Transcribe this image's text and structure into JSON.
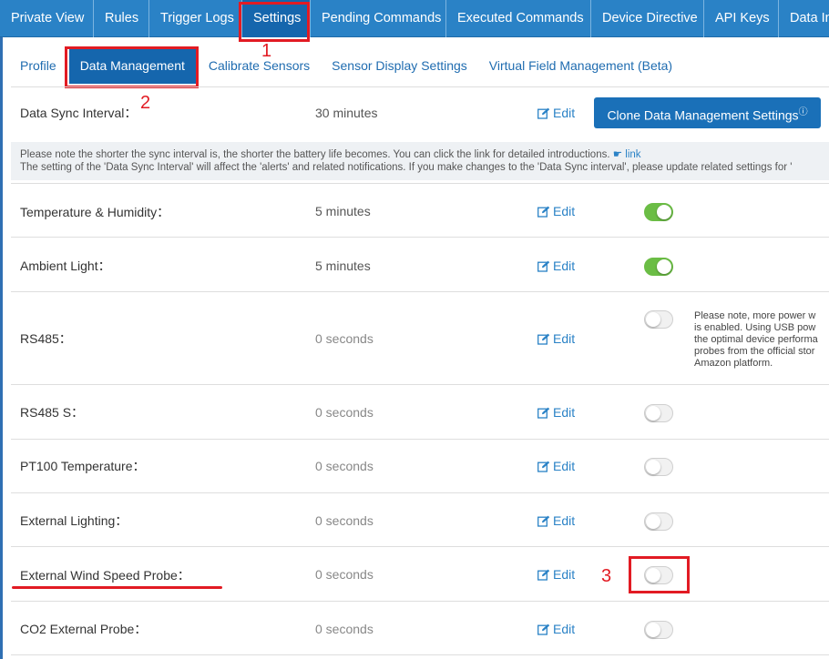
{
  "top_nav": [
    {
      "label": "Private View",
      "active": false
    },
    {
      "label": "Rules",
      "active": false
    },
    {
      "label": "Trigger Logs",
      "active": false
    },
    {
      "label": "Settings",
      "active": true
    },
    {
      "label": "Pending Commands",
      "active": false
    },
    {
      "label": "Executed Commands",
      "active": false
    },
    {
      "label": "Device Directive",
      "active": false
    },
    {
      "label": "API Keys",
      "active": false
    },
    {
      "label": "Data In",
      "active": false
    }
  ],
  "sub_nav": [
    {
      "label": "Profile",
      "active": false
    },
    {
      "label": "Data Management",
      "active": true
    },
    {
      "label": "Calibrate Sensors",
      "active": false
    },
    {
      "label": "Sensor Display Settings",
      "active": false
    },
    {
      "label": "Virtual Field Management (Beta)",
      "active": false
    }
  ],
  "annotations": {
    "n1": "1",
    "n2": "2",
    "n3": "3"
  },
  "sync": {
    "label": "Data Sync Interval：",
    "value": "30 minutes",
    "edit": "Edit"
  },
  "clone_button": "Clone Data Management Settings",
  "clone_help_icon": "question-circle-icon",
  "notice": {
    "line1": "Please note the shorter the sync interval is, the shorter the battery life becomes. You can click the link for detailed introductions.",
    "link_label": "link",
    "line2": "The setting of the 'Data Sync Interval' will affect the 'alerts' and related notifications. If you make changes to the 'Data Sync interval', please update related settings for '"
  },
  "rows": [
    {
      "label": "Temperature & Humidity：",
      "value": "5 minutes",
      "edit": "Edit",
      "enabled": true
    },
    {
      "label": "Ambient Light：",
      "value": "5 minutes",
      "edit": "Edit",
      "enabled": true
    },
    {
      "label": "RS485：",
      "value": "0 seconds",
      "edit": "Edit",
      "enabled": false
    },
    {
      "label": "RS485 S：",
      "value": "0 seconds",
      "edit": "Edit",
      "enabled": false
    },
    {
      "label": "PT100 Temperature：",
      "value": "0 seconds",
      "edit": "Edit",
      "enabled": false
    },
    {
      "label": "External Lighting：",
      "value": "0 seconds",
      "edit": "Edit",
      "enabled": false
    },
    {
      "label": "External Wind Speed Probe：",
      "value": "0 seconds",
      "edit": "Edit",
      "enabled": false
    },
    {
      "label": "CO2 External Probe：",
      "value": "0 seconds",
      "edit": "Edit",
      "enabled": false
    }
  ],
  "rs485_note": [
    "Please note, more power w",
    "is enabled. Using USB pow",
    "the optimal device performa",
    "probes from the official stor",
    "Amazon platform."
  ],
  "colors": {
    "accent": "#2a82c6",
    "nav_active": "#1566ad",
    "toggle_on": "#6bbd45",
    "annotation": "#e21b23"
  }
}
